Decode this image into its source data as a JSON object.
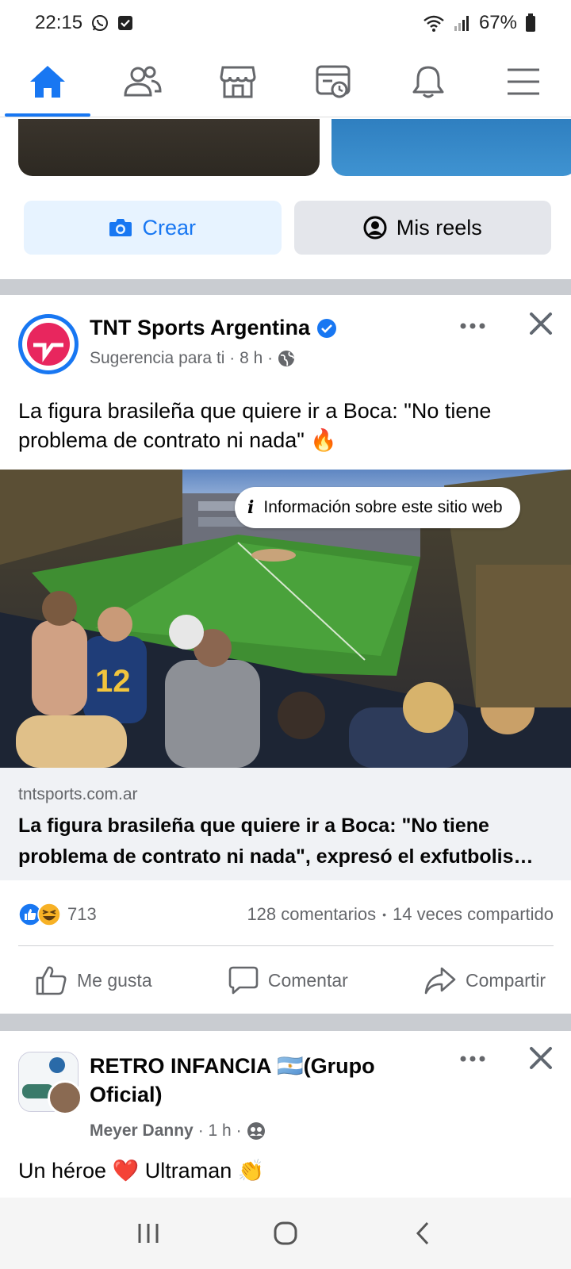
{
  "status_bar": {
    "time": "22:15",
    "battery": "67%"
  },
  "nav": {
    "tabs": [
      {
        "name": "home",
        "icon": "home-icon"
      },
      {
        "name": "friends",
        "icon": "friends-icon"
      },
      {
        "name": "marketplace",
        "icon": "marketplace-icon"
      },
      {
        "name": "feeds",
        "icon": "feeds-icon"
      },
      {
        "name": "notifications",
        "icon": "bell-icon"
      },
      {
        "name": "menu",
        "icon": "menu-icon"
      }
    ],
    "active_color": "#1877f2"
  },
  "reels": {
    "create_label": "Crear",
    "my_reels_label": "Mis reels"
  },
  "post1": {
    "author": "TNT Sports Argentina",
    "meta": "Sugerencia para ti · 8 h ·",
    "text": "La figura brasileña que quiere ir a Boca: \"No tiene problema de contrato ni nada\" 🔥",
    "info_pill": "Información sobre este sitio web",
    "link_domain": "tntsports.com.ar",
    "link_title": "La figura brasileña que quiere ir a Boca: \"No tiene problema de contrato ni nada\", expresó el exfutbolis…",
    "reaction_count": "713",
    "comments": "128 comentarios",
    "shares": "14 veces compartido",
    "dot": "•",
    "actions": {
      "like": "Me gusta",
      "comment": "Comentar",
      "share": "Compartir"
    }
  },
  "post2": {
    "author": "RETRO INFANCIA 🇦🇷(Grupo Oficial)",
    "meta_name": "Meyer Danny",
    "meta_time": "· 1 h ·",
    "text": "Un héroe ❤️ Ultraman 👏"
  },
  "colors": {
    "brand": "#1877f2",
    "divider": "#c9ccd1",
    "secondary_text": "#65676b"
  }
}
